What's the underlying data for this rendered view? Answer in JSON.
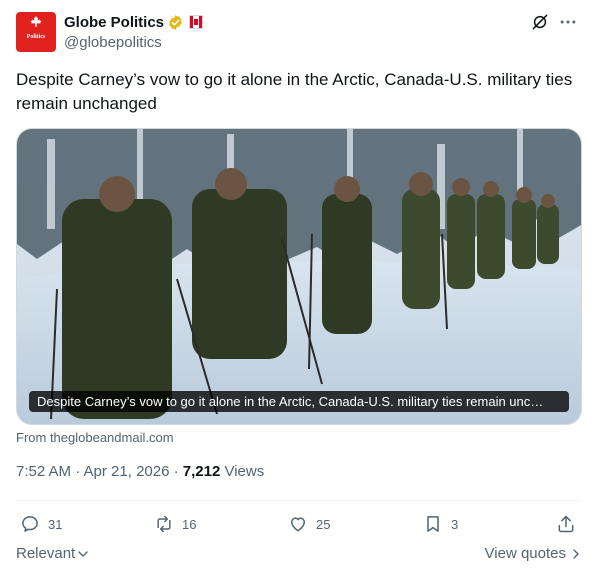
{
  "post": {
    "author": {
      "display_name": "Globe Politics",
      "handle": "@globepolitics",
      "avatar_text": "Politics",
      "verified_icon": "gold-verified-badge-icon",
      "flag_icon": "canada-flag-icon"
    },
    "text": "Despite Carney’s vow to go it alone in the Arctic, Canada-U.S. military ties remain unchanged",
    "media": {
      "caption": "Despite Carney’s vow to go it alone in the Arctic, Canada-U.S. military ties remain unc…"
    },
    "source": "From theglobeandmail.com",
    "timestamp": "7:52 AM · Apr 21, 2026 · ",
    "views_count": "7,212",
    "views_label": " Views"
  },
  "actions": {
    "replies": "31",
    "reposts": "16",
    "likes": "25",
    "bookmarks": "3"
  },
  "footer": {
    "sort_label": "Relevant",
    "view_quotes_label": "View quotes"
  },
  "colors": {
    "text": "#0f1419",
    "secondary": "#536471",
    "border": "#cfd9de",
    "divider": "#eff3f4",
    "avatar_bg": "#e0211d",
    "verified_gold": "#e2b719"
  }
}
